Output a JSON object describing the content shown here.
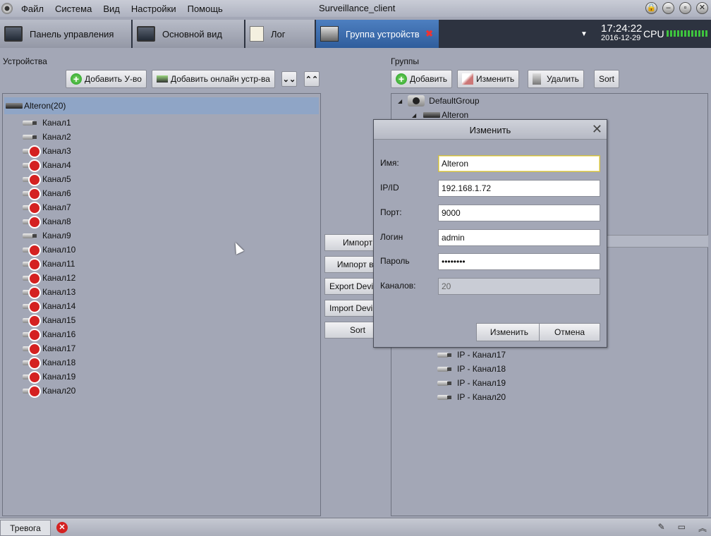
{
  "menu": {
    "items": [
      "Файл",
      "Система",
      "Вид",
      "Настройки",
      "Помощь"
    ],
    "title": "Surveillance_client"
  },
  "window_buttons": [
    "lock-icon",
    "minimize-icon",
    "maximize-icon",
    "close-icon"
  ],
  "tabs": [
    {
      "label": "Панель управления",
      "icon": "dashboard-icon"
    },
    {
      "label": "Основной вид",
      "icon": "monitor-icon"
    },
    {
      "label": "Лог",
      "icon": "log-icon"
    },
    {
      "label": "Группа устройств",
      "icon": "device-group-icon",
      "active": true
    }
  ],
  "clock": {
    "time": "17:24:22",
    "date": "2016-12-29"
  },
  "cpu": {
    "label": "CPU"
  },
  "devices": {
    "title": "Устройства",
    "add_label": "Добавить У-во",
    "add_online_label": "Добавить онлайн устр-ва",
    "root": "Alteron(20)",
    "channels": [
      {
        "name": "Канал1",
        "online": true
      },
      {
        "name": "Канал2",
        "online": true
      },
      {
        "name": "Канал3",
        "online": false
      },
      {
        "name": "Канал4",
        "online": false
      },
      {
        "name": "Канал5",
        "online": false
      },
      {
        "name": "Канал6",
        "online": false
      },
      {
        "name": "Канал7",
        "online": false
      },
      {
        "name": "Канал8",
        "online": false
      },
      {
        "name": "Канал9",
        "online": true
      },
      {
        "name": "Канал10",
        "online": false
      },
      {
        "name": "Канал11",
        "online": false
      },
      {
        "name": "Канал12",
        "online": false
      },
      {
        "name": "Канал13",
        "online": false
      },
      {
        "name": "Канал14",
        "online": false
      },
      {
        "name": "Канал15",
        "online": false
      },
      {
        "name": "Канал16",
        "online": false
      },
      {
        "name": "Канал17",
        "online": false
      },
      {
        "name": "Канал18",
        "online": false
      },
      {
        "name": "Канал19",
        "online": false
      },
      {
        "name": "Канал20",
        "online": false
      }
    ]
  },
  "middle": {
    "buttons": [
      "Импорт",
      "Импорт во",
      "Export Devi",
      "Import Devi",
      "Sort"
    ]
  },
  "groups": {
    "title": "Группы",
    "add_label": "Добавить",
    "edit_label": "Изменить",
    "delete_label": "Удалить",
    "sort_label": "Sort",
    "root": "DefaultGroup",
    "device": "Alteron",
    "channels": [
      "IP - Канал17",
      "IP - Канал18",
      "IP - Канал19",
      "IP - Канал20"
    ]
  },
  "dialog": {
    "title": "Изменить",
    "name_label": "Имя:",
    "name_value": "Alteron",
    "ip_label": "IP/ID",
    "ip_value": "192.168.1.72",
    "port_label": "Порт:",
    "port_value": "9000",
    "login_label": "Логин",
    "login_value": "admin",
    "password_label": "Пароль",
    "password_value": "••••••••",
    "channels_label": "Каналов:",
    "channels_value": "20",
    "ok_label": "Изменить",
    "cancel_label": "Отмена"
  },
  "statusbar": {
    "alarm_label": "Тревога"
  }
}
